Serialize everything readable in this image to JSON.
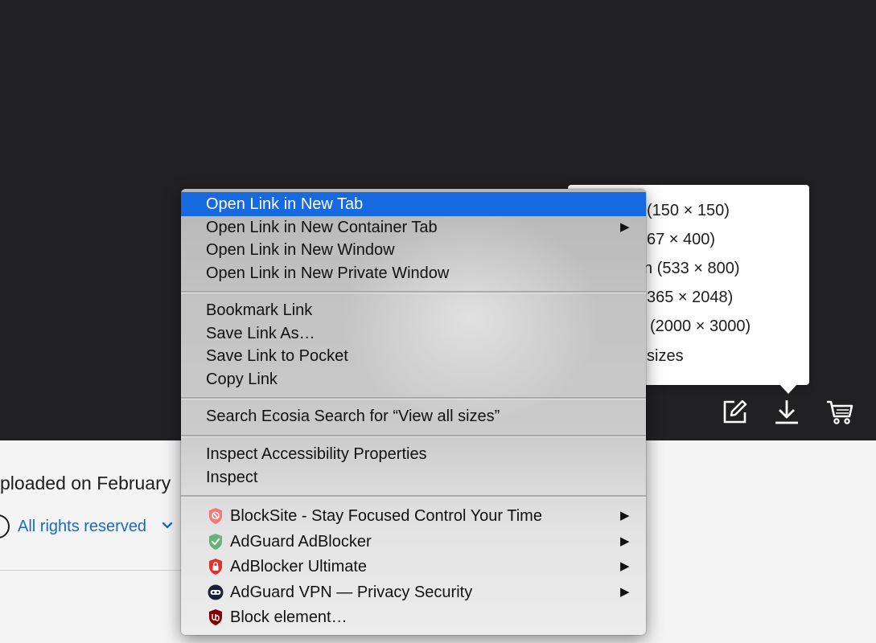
{
  "page": {
    "upload_text": "ploaded on February",
    "license_label": "All rights reserved"
  },
  "size_popup": {
    "items": [
      "(150 × 150)",
      "67 × 400)",
      "n (533 × 800)",
      "365 × 2048)",
      "(2000 × 3000)",
      "sizes"
    ]
  },
  "toolbar": {
    "icons": [
      "edit-icon",
      "download-icon",
      "cart-icon"
    ]
  },
  "context_menu": {
    "items": [
      "Open Link in New Tab",
      "Open Link in New Container Tab",
      "Open Link in New Window",
      "Open Link in New Private Window",
      "Bookmark Link",
      "Save Link As…",
      "Save Link to Pocket",
      "Copy Link",
      "Search Ecosia Search for “View all sizes”",
      "Inspect Accessibility Properties",
      "Inspect"
    ],
    "extensions": [
      {
        "label": "BlockSite - Stay Focused  Control Your Time",
        "icon": "blocksite-icon"
      },
      {
        "label": "AdGuard AdBlocker",
        "icon": "adguard-shield-icon"
      },
      {
        "label": "AdBlocker Ultimate",
        "icon": "adblocker-ultimate-icon"
      },
      {
        "label": "AdGuard VPN — Privacy  Security",
        "icon": "adguard-vpn-icon"
      },
      {
        "label": "Block element…",
        "icon": "ublock-icon"
      }
    ],
    "submenu_arrow": "▶",
    "highlight_color": "#1769e0"
  }
}
